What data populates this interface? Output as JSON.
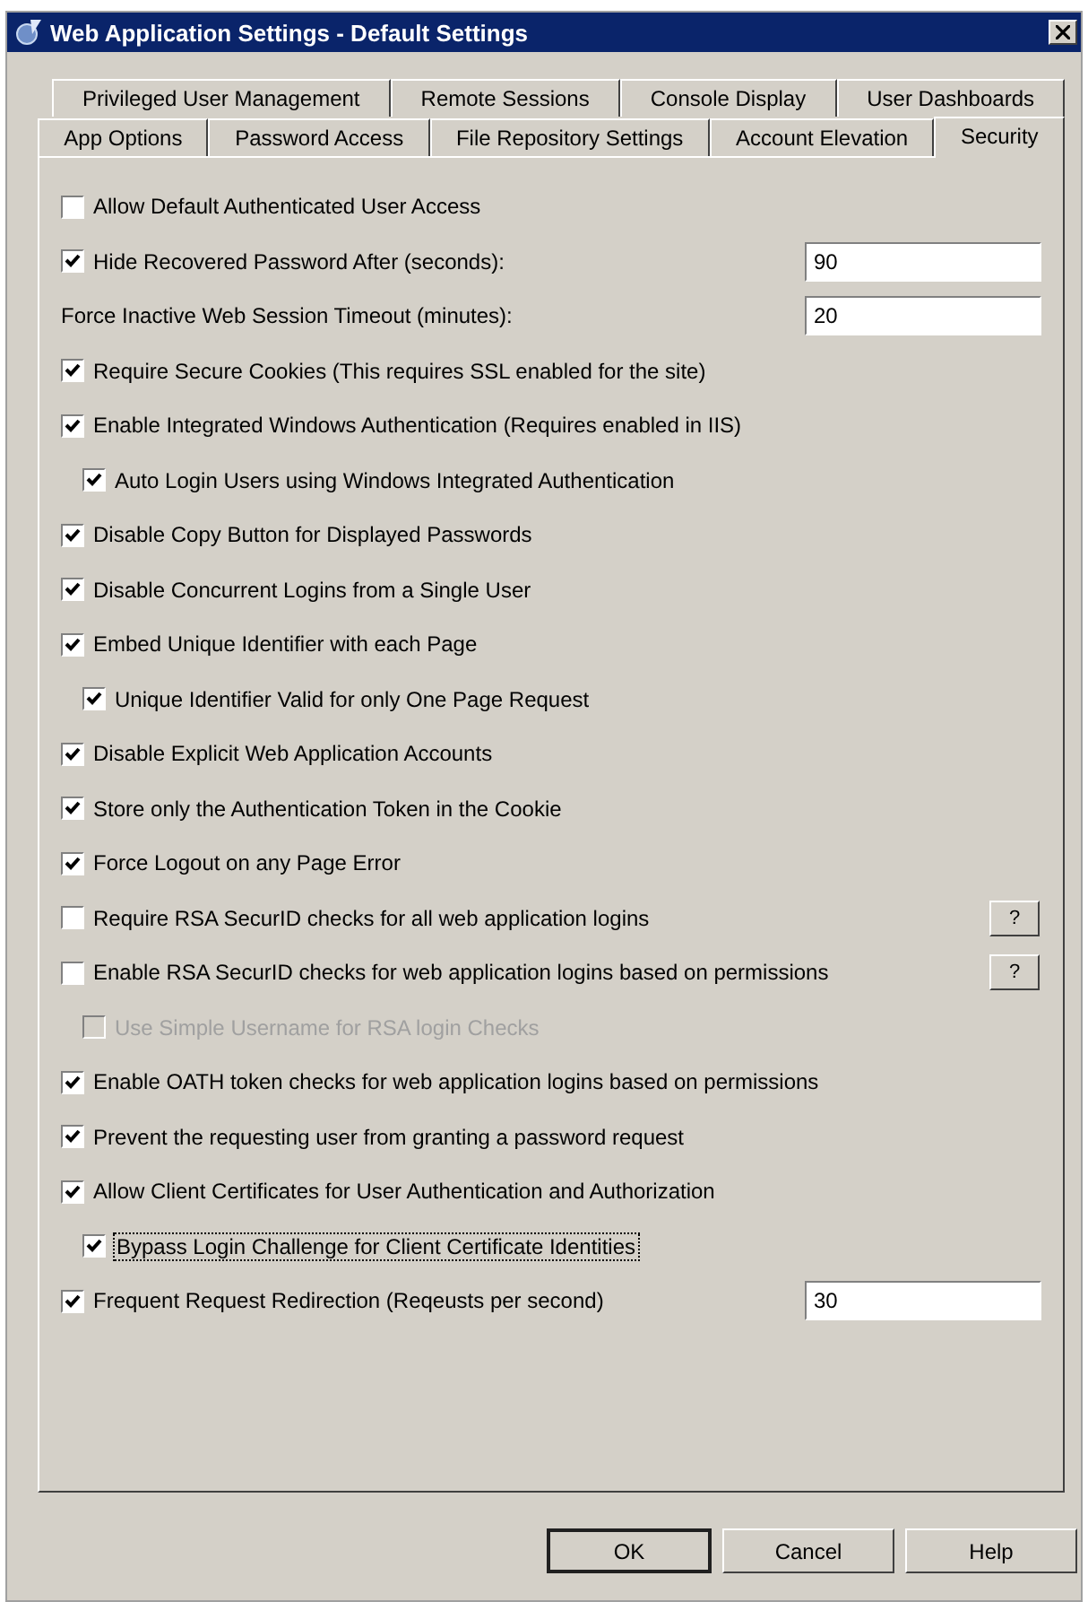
{
  "window": {
    "title": "Web Application Settings - Default Settings"
  },
  "tab_rows": [
    {
      "tabs": [
        {
          "label": "Privileged User Management",
          "selected": false
        },
        {
          "label": "Remote Sessions",
          "selected": false
        },
        {
          "label": "Console Display",
          "selected": false
        },
        {
          "label": "User Dashboards",
          "selected": false
        }
      ]
    },
    {
      "tabs": [
        {
          "label": "App Options",
          "selected": false
        },
        {
          "label": "Password Access",
          "selected": false
        },
        {
          "label": "File Repository Settings",
          "selected": false
        },
        {
          "label": "Account Elevation",
          "selected": false
        },
        {
          "label": "Security",
          "selected": true
        }
      ]
    }
  ],
  "settings": [
    {
      "kind": "checkbox",
      "label": "Allow Default Authenticated User Access",
      "checked": false,
      "disabled": false,
      "focused": false
    },
    {
      "kind": "checkbox",
      "label": "Hide Recovered Password After (seconds):",
      "checked": true,
      "disabled": false,
      "focused": false,
      "value": "90"
    },
    {
      "kind": "label",
      "label": "Force Inactive Web Session Timeout (minutes):",
      "value": "20"
    },
    {
      "kind": "checkbox",
      "label": "Require Secure Cookies (This requires SSL enabled for the site)",
      "checked": true,
      "disabled": false,
      "focused": false
    },
    {
      "kind": "checkbox",
      "label": "Enable Integrated Windows Authentication (Requires enabled in IIS)",
      "checked": true,
      "disabled": false,
      "focused": false,
      "children": [
        {
          "kind": "checkbox",
          "label": "Auto Login Users using Windows Integrated Authentication",
          "checked": true,
          "disabled": false,
          "focused": false
        }
      ]
    },
    {
      "kind": "checkbox",
      "label": "Disable Copy Button for Displayed Passwords",
      "checked": true,
      "disabled": false,
      "focused": false
    },
    {
      "kind": "checkbox",
      "label": "Disable Concurrent Logins from a Single User",
      "checked": true,
      "disabled": false,
      "focused": false
    },
    {
      "kind": "checkbox",
      "label": "Embed Unique Identifier with each Page",
      "checked": true,
      "disabled": false,
      "focused": false,
      "children": [
        {
          "kind": "checkbox",
          "label": "Unique Identifier Valid for only One Page Request",
          "checked": true,
          "disabled": false,
          "focused": false
        }
      ]
    },
    {
      "kind": "checkbox",
      "label": "Disable Explicit Web Application Accounts",
      "checked": true,
      "disabled": false,
      "focused": false
    },
    {
      "kind": "checkbox",
      "label": "Store only the Authentication Token in the Cookie",
      "checked": true,
      "disabled": false,
      "focused": false
    },
    {
      "kind": "checkbox",
      "label": "Force Logout on any Page Error",
      "checked": true,
      "disabled": false,
      "focused": false
    },
    {
      "kind": "checkbox",
      "label": "Require RSA SecurID checks for all web application logins",
      "checked": false,
      "disabled": false,
      "focused": false,
      "help": "?"
    },
    {
      "kind": "checkbox",
      "label": "Enable RSA SecurID checks for web application logins based on permissions",
      "checked": false,
      "disabled": false,
      "focused": false,
      "help": "?",
      "children": [
        {
          "kind": "checkbox",
          "label": "Use Simple Username for RSA login Checks",
          "checked": false,
          "disabled": true,
          "focused": false
        }
      ]
    },
    {
      "kind": "checkbox",
      "label": "Enable OATH token checks for web application logins based on permissions",
      "checked": true,
      "disabled": false,
      "focused": false
    },
    {
      "kind": "checkbox",
      "label": "Prevent the requesting user from granting a password request",
      "checked": true,
      "disabled": false,
      "focused": false
    },
    {
      "kind": "checkbox",
      "label": "Allow Client Certificates for User Authentication and Authorization",
      "checked": true,
      "disabled": false,
      "focused": false,
      "children": [
        {
          "kind": "checkbox",
          "label": "Bypass Login Challenge for Client Certificate Identities",
          "checked": true,
          "disabled": false,
          "focused": true
        }
      ]
    },
    {
      "kind": "checkbox",
      "label": "Frequent Request Redirection (Reqeusts per second)",
      "checked": true,
      "disabled": false,
      "focused": false,
      "value": "30"
    }
  ],
  "buttons": [
    {
      "label": "OK",
      "default": true
    },
    {
      "label": "Cancel",
      "default": false
    },
    {
      "label": "Help",
      "default": false
    }
  ]
}
